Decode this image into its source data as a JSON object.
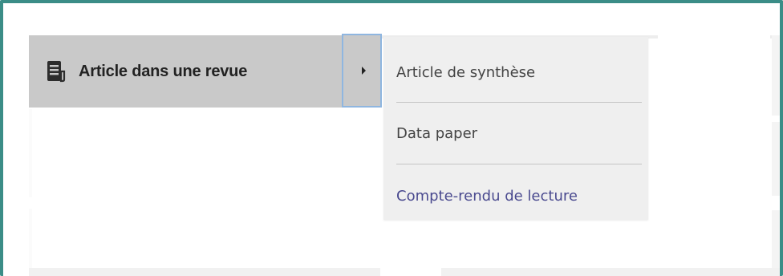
{
  "menu": {
    "item_label": "Article dans une revue",
    "item_icon": "document-icon"
  },
  "submenu": {
    "items": [
      {
        "label": "Article de synthèse"
      },
      {
        "label": "Data paper"
      },
      {
        "label": "Compte-rendu de lecture"
      }
    ]
  },
  "colors": {
    "frame_border": "#3b8d87",
    "menu_item_bg": "#c9c9c9",
    "submenu_bg": "#efefef",
    "toggle_focus": "#8fb6e0",
    "hover_link": "#4a4a8f"
  }
}
